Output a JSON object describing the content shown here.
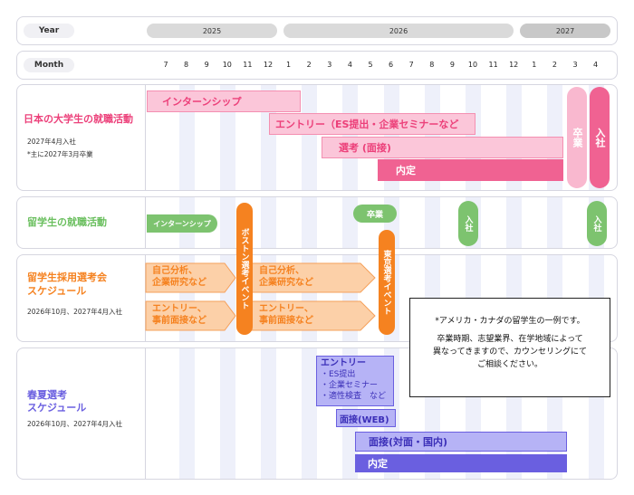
{
  "header": {
    "year_label": "Year",
    "month_label": "Month",
    "years": [
      "2025",
      "2026",
      "2027"
    ],
    "months": [
      "7",
      "8",
      "9",
      "10",
      "11",
      "12",
      "1",
      "2",
      "3",
      "4",
      "5",
      "6",
      "7",
      "8",
      "9",
      "10",
      "11",
      "12",
      "1",
      "2",
      "3",
      "4"
    ]
  },
  "sections": {
    "japan": {
      "title": "日本の大学生の就職活動",
      "sub1": "2027年4月入社",
      "sub2": "*主に2027年3月卒業",
      "bars": {
        "internship": "インターンシップ",
        "entry": "エントリー（ES提出・企業セミナーなど",
        "selection": "選考 (面接)",
        "offer": "内定",
        "graduate": "卒業",
        "join": "入社"
      }
    },
    "intl": {
      "title": "留学生の就職活動",
      "internship": "インターンシップ",
      "graduate": "卒業",
      "join1": "入社",
      "join2": "入社"
    },
    "selection_fair": {
      "title1": "留学生採用選考会",
      "title2": "スケジュール",
      "sub": "2026年10月、2027年4月入社",
      "boston": "ボストン選考イベント",
      "tokyo": "東京選考イベント",
      "arrow1a": "自己分析、",
      "arrow1b": "企業研究など",
      "arrow2a": "エントリー、",
      "arrow2b": "事前面接など",
      "arrow3a": "自己分析、",
      "arrow3b": "企業研究など",
      "arrow4a": "エントリー、",
      "arrow4b": "事前面接など"
    },
    "spring_summer": {
      "title1": "春夏選考",
      "title2": "スケジュール",
      "sub": "2026年10月、2027年4月入社",
      "entry_title": "エントリー",
      "entry_items": [
        "・ES提出",
        "・企業セミナー",
        "・適性検査　など"
      ],
      "web": "面接(WEB)",
      "in_person": "面接(対面・国内)",
      "offer": "内定"
    }
  },
  "note": {
    "line1": "*アメリカ・カナダの留学生の一例です。",
    "line2": "卒業時期、志望業界、在学地域によって",
    "line3": "異なってきますので、カウンセリングにて",
    "line4": "ご相談ください。"
  },
  "colors": {
    "pink_light": "#f9b8cf",
    "pink_dark": "#f06292",
    "green": "#7dc36f",
    "orange": "#f58220",
    "orange_light": "#fcd0a8",
    "purple": "#6a5fe0",
    "purple_light": "#b6b3f6"
  }
}
